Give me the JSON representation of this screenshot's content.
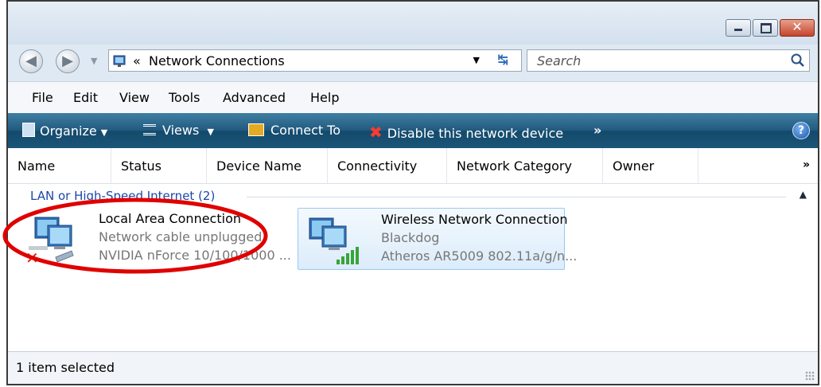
{
  "window": {
    "caption_buttons": [
      "minimize",
      "maximize",
      "close"
    ]
  },
  "nav": {
    "address_prefix": "«",
    "address_text": "Network Connections",
    "search_placeholder": "Search"
  },
  "menu": {
    "items": [
      "File",
      "Edit",
      "View",
      "Tools",
      "Advanced",
      "Help"
    ]
  },
  "toolbar": {
    "organize": "Organize",
    "views": "Views",
    "connect_to": "Connect To",
    "disable": "Disable this network device",
    "more": "»",
    "help": "?"
  },
  "columns": [
    "Name",
    "Status",
    "Device Name",
    "Connectivity",
    "Network Category",
    "Owner"
  ],
  "columns_more": "»",
  "group": {
    "label": "LAN or High-Speed Internet (2)"
  },
  "items": [
    {
      "name": "Local Area Connection",
      "status": "Network cable unplugged",
      "device": "NVIDIA nForce 10/100/1000 ...",
      "icon": "wired-network-disconnected-icon",
      "selected": false
    },
    {
      "name": "Wireless Network Connection",
      "status": "Blackdog",
      "device": "Atheros AR5009 802.11a/g/n...",
      "icon": "wireless-network-signal-icon",
      "selected": true
    }
  ],
  "status_bar": {
    "text": "1 item selected"
  },
  "colors": {
    "toolbar_bg": "#1c5578",
    "group_text": "#1b48a8",
    "annotation": "#e00000",
    "selection_border": "#99c9ef"
  }
}
